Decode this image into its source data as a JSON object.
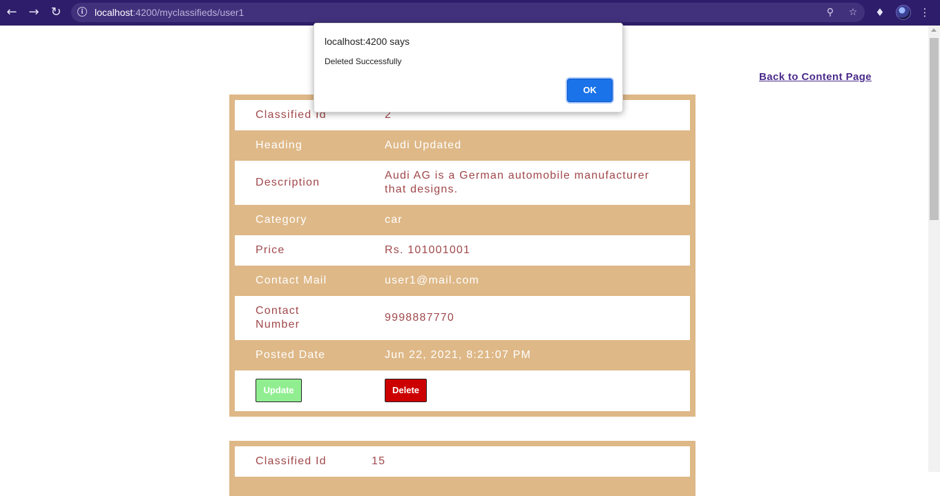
{
  "browser": {
    "url_host": "localhost",
    "url_rest": ":4200/myclassifieds/user1",
    "icons": {
      "back": "arrow-left-icon",
      "forward": "arrow-right-icon",
      "reload": "reload-icon",
      "site_info": "info-icon",
      "password": "key-icon",
      "bookmark": "star-icon",
      "extensions": "puzzle-icon",
      "menu": "kebab-menu-icon"
    }
  },
  "page": {
    "back_link": "Back to Content Page"
  },
  "classified1": {
    "rows": [
      {
        "label": "Classified Id",
        "value": "2"
      },
      {
        "label": "Heading",
        "value": "Audi Updated"
      },
      {
        "label": "Description",
        "value": "Audi AG is a German automobile manufacturer that designs."
      },
      {
        "label": "Category",
        "value": "car"
      },
      {
        "label": "Price",
        "value": "Rs. 101001001"
      },
      {
        "label": "Contact Mail",
        "value": "user1@mail.com"
      },
      {
        "label": "Contact Number",
        "value": "9998887770"
      },
      {
        "label": "Posted Date",
        "value": "Jun 22, 2021, 8:21:07 PM"
      }
    ],
    "update_label": "Update",
    "delete_label": "Delete"
  },
  "classified2": {
    "rows": [
      {
        "label": "Classified Id",
        "value": "15"
      }
    ]
  },
  "dialog": {
    "title": "localhost:4200 says",
    "message": "Deleted Successfully",
    "ok_label": "OK"
  },
  "colors": {
    "card_tan": "#deb887",
    "text_maroon": "#a0474a",
    "update_green": "#90ee90",
    "delete_red": "#cc0000",
    "dialog_blue": "#1a73e8",
    "chrome_purple": "#2e1d6b"
  }
}
